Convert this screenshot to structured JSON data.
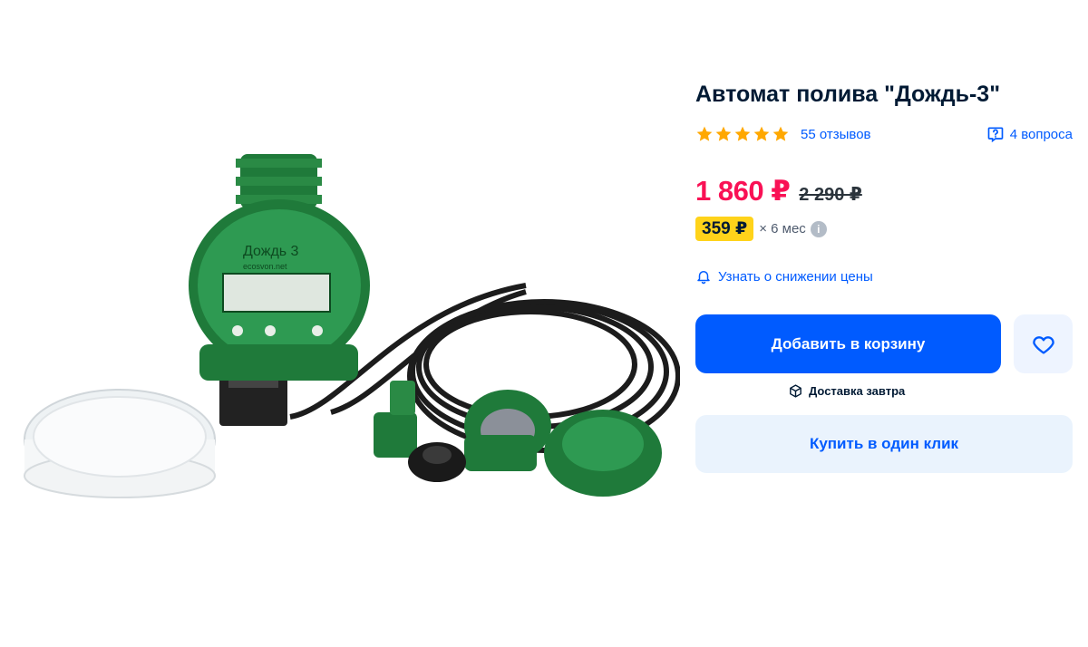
{
  "product": {
    "title": "Автомат полива \"Дождь-3\"",
    "image_alt": "Таймер полива Дождь-3 с комплектом шланга и фитингов",
    "device_label": "Дождь 3",
    "device_sublabel": "ecosvon.net"
  },
  "rating": {
    "stars": 5,
    "reviews_label": "55 отзывов",
    "questions_label": "4 вопроса"
  },
  "pricing": {
    "price": "1 860 ₽",
    "old_price": "2 290 ₽",
    "installment_amount": "359 ₽",
    "installment_term": "× 6 мес",
    "info_glyph": "i"
  },
  "actions": {
    "price_alert_label": "Узнать о снижении цены",
    "add_to_cart_label": "Добавить в корзину",
    "delivery_label": "Доставка завтра",
    "buy_one_click_label": "Купить в один клик"
  },
  "icons": {
    "star": "star-icon",
    "question": "question-bubble-icon",
    "bell": "bell-icon",
    "heart": "heart-icon",
    "box": "box-icon",
    "info": "info-icon"
  },
  "colors": {
    "accent_blue": "#005bff",
    "price_red": "#f91155",
    "star_yellow": "#ffa800",
    "installment_yellow": "#ffd31a",
    "device_green": "#1f7a3a"
  }
}
